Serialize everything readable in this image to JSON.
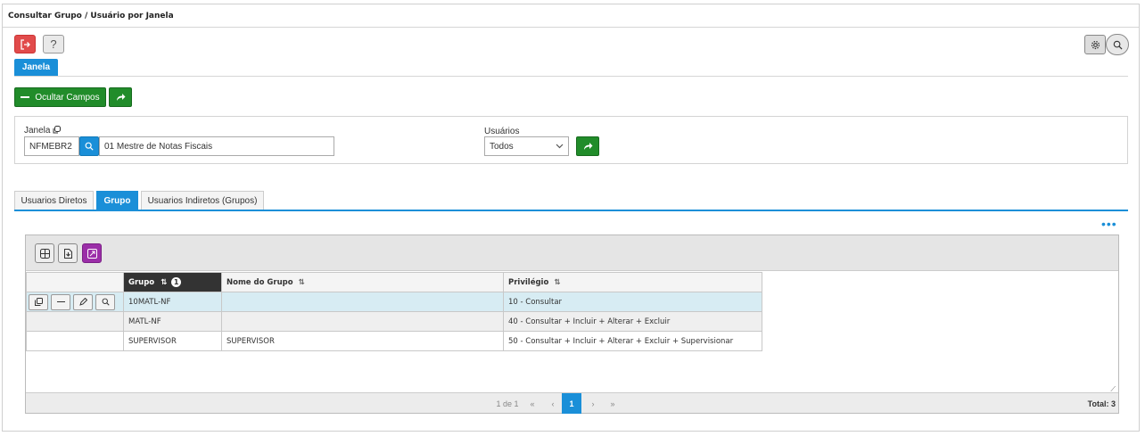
{
  "window": {
    "title": "Consultar Grupo / Usuário por Janela"
  },
  "toolbar": {
    "exit_icon": "exit-icon",
    "help_label": "?",
    "settings_icon": "gear-icon",
    "search_icon": "search-icon"
  },
  "top_tab": {
    "label": "Janela"
  },
  "actions": {
    "hide_fields_label": "Ocultar Campos"
  },
  "filters": {
    "janela_label": "Janela",
    "janela_code": "NFMEBR2",
    "janela_desc": "01  Mestre de Notas Fiscais",
    "usuarios_label": "Usuários",
    "usuarios_value": "Todos"
  },
  "tabs": [
    {
      "label": "Usuarios Diretos"
    },
    {
      "label": "Grupo"
    },
    {
      "label": "Usuarios Indiretos (Grupos)"
    }
  ],
  "grid": {
    "columns": [
      "Grupo",
      "Nome do Grupo",
      "Privilégio"
    ],
    "sort_badge": "1",
    "rows": [
      [
        "10MATL-NF",
        "",
        "10 - Consultar"
      ],
      [
        "MATL-NF",
        "",
        "40 - Consultar + Incluir + Alterar + Excluir"
      ],
      [
        "SUPERVISOR",
        "SUPERVISOR",
        "50 - Consultar + Incluir + Alterar + Excluir + Supervisionar"
      ]
    ]
  },
  "pagination": {
    "info": "1 de 1",
    "first": "«",
    "prev": "‹",
    "current": "1",
    "next": "›",
    "last": "»",
    "total": "Total: 3"
  },
  "colors": {
    "accent": "#1a8fd8",
    "green": "#218c2a",
    "danger": "#e14b4b",
    "purple": "#9b2ea8"
  }
}
